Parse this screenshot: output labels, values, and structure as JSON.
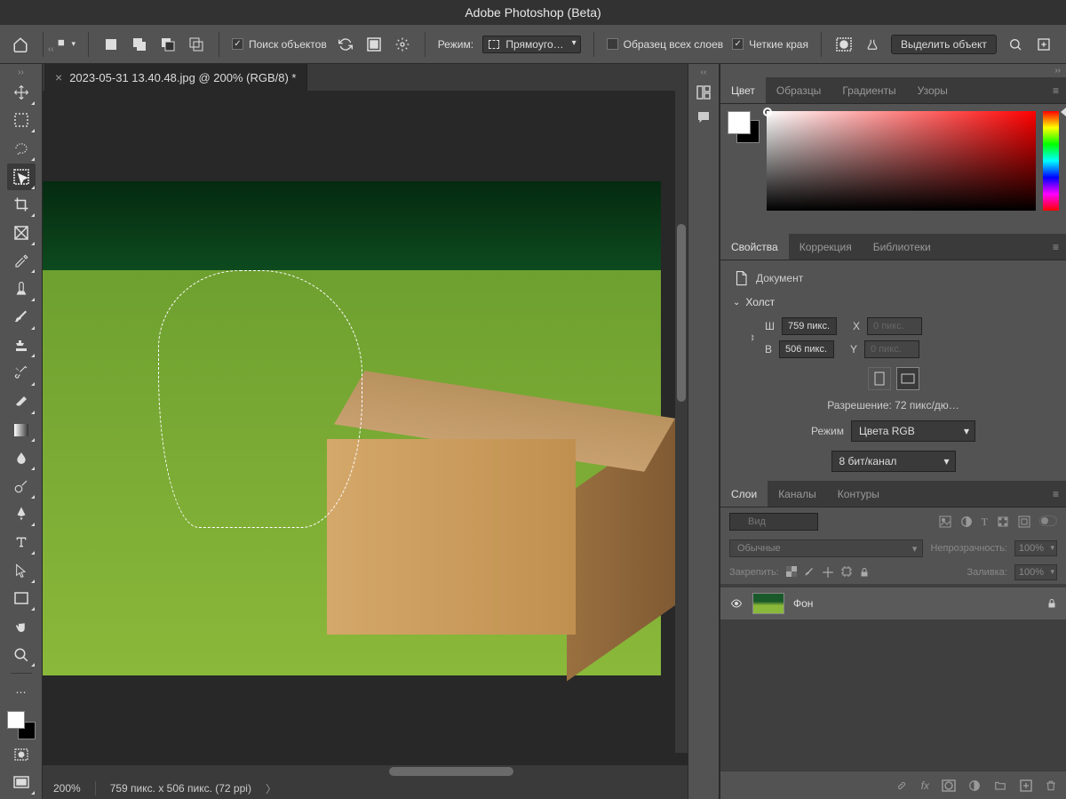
{
  "app_title": "Adobe Photoshop (Beta)",
  "options": {
    "find_objects": "Поиск объектов",
    "mode_label": "Режим:",
    "mode_value": "Прямоуго…",
    "sample_all_layers": "Образец всех слоев",
    "hard_edges": "Четкие края",
    "select_subject": "Выделить объект"
  },
  "document": {
    "tab_title": "2023-05-31 13.40.48.jpg @ 200% (RGB/8) *",
    "zoom": "200%",
    "dimensions_status": "759 пикс. x 506 пикс. (72 ppi)"
  },
  "panels": {
    "color_tabs": [
      "Цвет",
      "Образцы",
      "Градиенты",
      "Узоры"
    ],
    "props_tabs": [
      "Свойства",
      "Коррекция",
      "Библиотеки"
    ],
    "layers_tabs": [
      "Слои",
      "Каналы",
      "Контуры"
    ]
  },
  "properties": {
    "document_label": "Документ",
    "canvas_label": "Холст",
    "w_label": "Ш",
    "w_value": "759 пикс.",
    "h_label": "В",
    "h_value": "506 пикс.",
    "x_label": "X",
    "x_value": "0 пикс.",
    "y_label": "Y",
    "y_value": "0 пикс.",
    "resolution": "Разрешение: 72 пикс/дю…",
    "mode_label": "Режим",
    "color_mode": "Цвета RGB",
    "bit_depth": "8 бит/канал"
  },
  "layers": {
    "filter_placeholder": "Вид",
    "blend_mode": "Обычные",
    "opacity_label": "Непрозрачность:",
    "opacity_value": "100%",
    "lock_label": "Закрепить:",
    "fill_label": "Заливка:",
    "fill_value": "100%",
    "items": [
      {
        "name": "Фон",
        "locked": true,
        "visible": true
      }
    ]
  }
}
